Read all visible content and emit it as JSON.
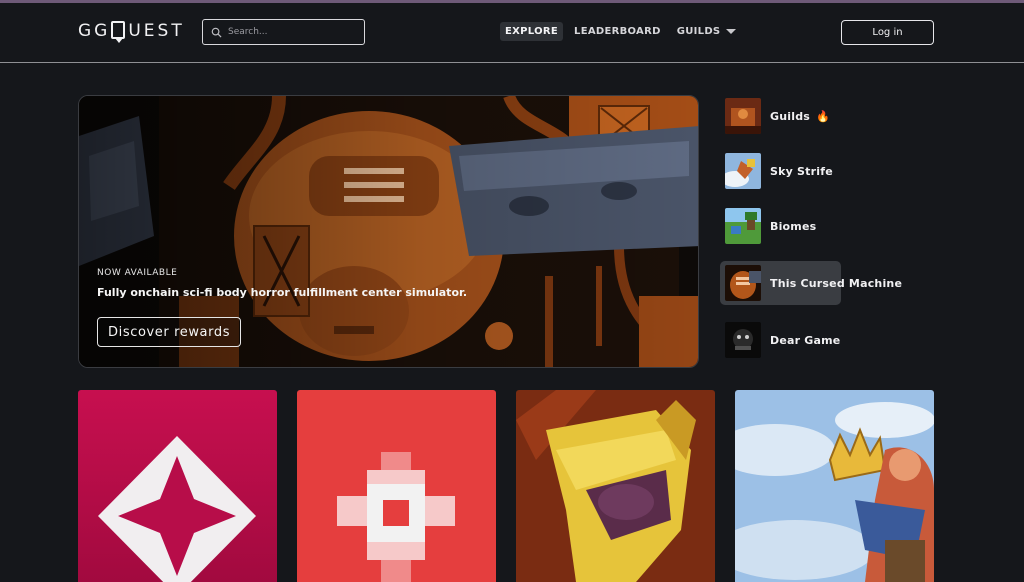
{
  "header": {
    "logo_left": "GG",
    "logo_right": "UEST",
    "search_placeholder": "Search...",
    "nav": [
      {
        "label": "EXPLORE",
        "active": true
      },
      {
        "label": "LEADERBOARD",
        "active": false
      },
      {
        "label": "GUILDS",
        "active": false
      }
    ],
    "login_label": "Log in"
  },
  "hero": {
    "kicker": "NOW AVAILABLE",
    "subtitle": "Fully onchain sci-fi body horror fulfillment center simulator.",
    "cta": "Discover rewards"
  },
  "sidebar": {
    "items": [
      {
        "label": "Guilds",
        "badge_icon": "fire-icon",
        "selected": false
      },
      {
        "label": "Sky Strife",
        "selected": false
      },
      {
        "label": "Biomes",
        "selected": false
      },
      {
        "label": "This Cursed Machine",
        "selected": true
      },
      {
        "label": "Dear Game",
        "selected": false
      }
    ]
  },
  "colors": {
    "background": "#15171b",
    "hero_orange": "#b2561a",
    "card_1": "#c40f4e",
    "card_2": "#e84040",
    "card_3": "#7a2c12",
    "card_4": "#9cc0e6"
  }
}
